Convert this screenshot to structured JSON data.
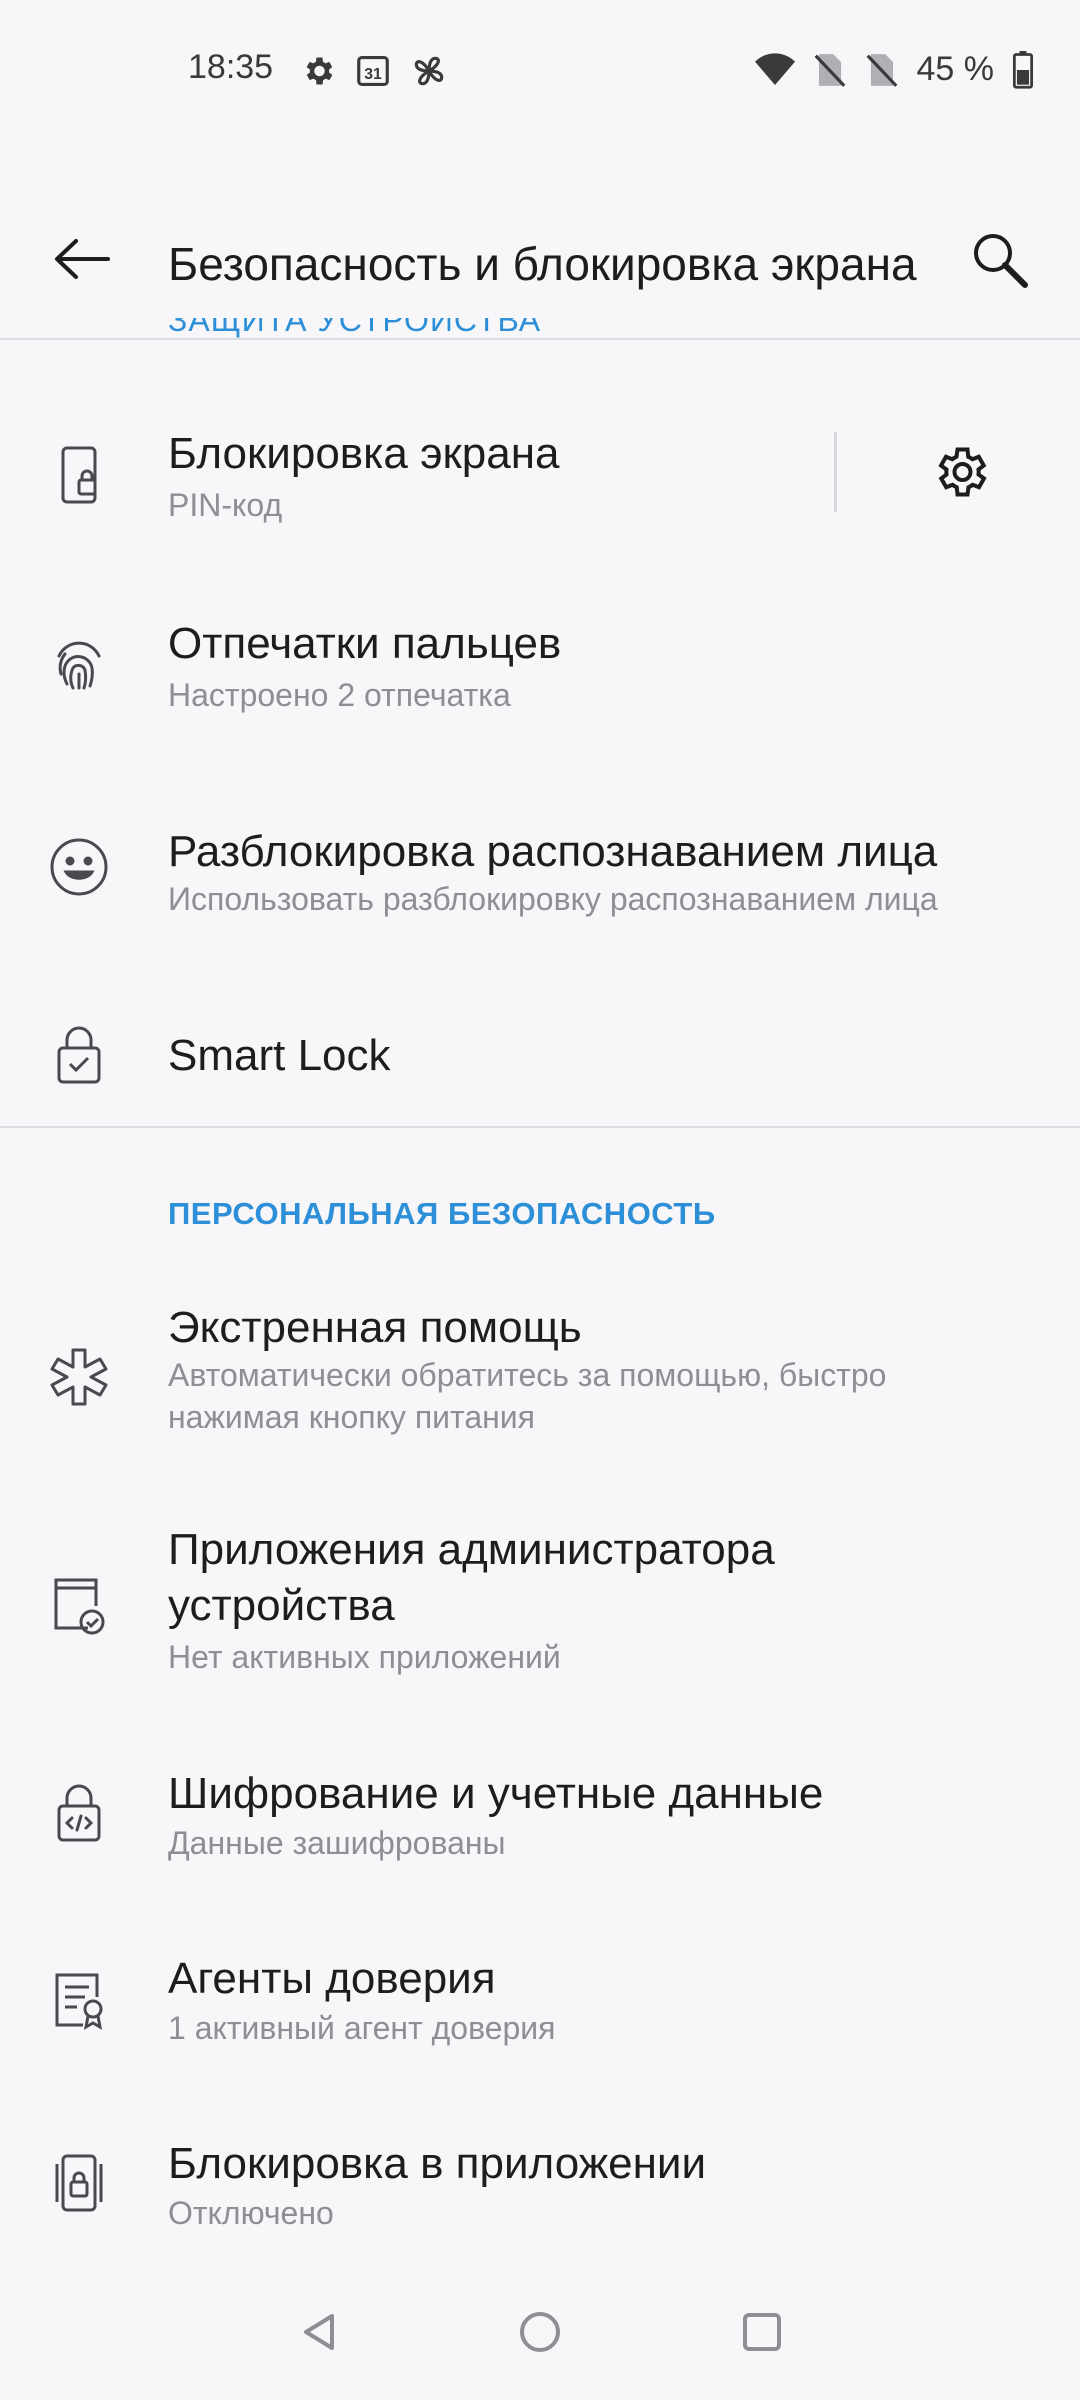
{
  "status_bar": {
    "time": "18:35",
    "battery": "45 %",
    "left_icons": [
      "gear-icon",
      "calendar-icon",
      "pinwheel-icon"
    ],
    "calendar_day": "31",
    "right_icons": [
      "wifi-icon",
      "no-sim-icon",
      "no-sim-icon",
      "battery-icon"
    ]
  },
  "app_bar": {
    "title": "Безопасность и блокировка экрана"
  },
  "sections": {
    "device_protection_cut": "ЗАЩИТА УСТРОЙСТВА",
    "personal_safety": "ПЕРСОНАЛЬНАЯ БЕЗОПАСНОСТЬ"
  },
  "items": [
    {
      "title": "Блокировка экрана",
      "subtitle": "PIN-код",
      "icon": "phone-lock-icon"
    },
    {
      "title": "Отпечатки пальцев",
      "subtitle": "Настроено 2 отпечатка",
      "icon": "fingerprint-icon"
    },
    {
      "title": "Разблокировка распознаванием лица",
      "subtitle": "Использовать разблокировку распознаванием лица",
      "icon": "face-icon"
    },
    {
      "title": "Smart Lock",
      "subtitle": "",
      "icon": "smart-lock-icon"
    },
    {
      "title": "Экстренная помощь",
      "subtitle": "Автоматически обратитесь за помощью, быстро нажимая кнопку питания",
      "icon": "emergency-icon"
    },
    {
      "title": "Приложения администратора устройства",
      "subtitle": "Нет активных приложений",
      "icon": "device-admin-icon"
    },
    {
      "title": "Шифрование и учетные данные",
      "subtitle": "Данные зашифрованы",
      "icon": "encryption-lock-icon"
    },
    {
      "title": "Агенты доверия",
      "subtitle": "1 активный агент доверия",
      "icon": "trust-agent-icon"
    },
    {
      "title": "Блокировка в приложении",
      "subtitle": "Отключено",
      "icon": "app-lock-icon"
    }
  ],
  "colors": {
    "accent": "#2d8fd8",
    "background": "#f7f7f9",
    "text_primary": "#1d1d1f",
    "text_secondary": "#8e8e93"
  }
}
